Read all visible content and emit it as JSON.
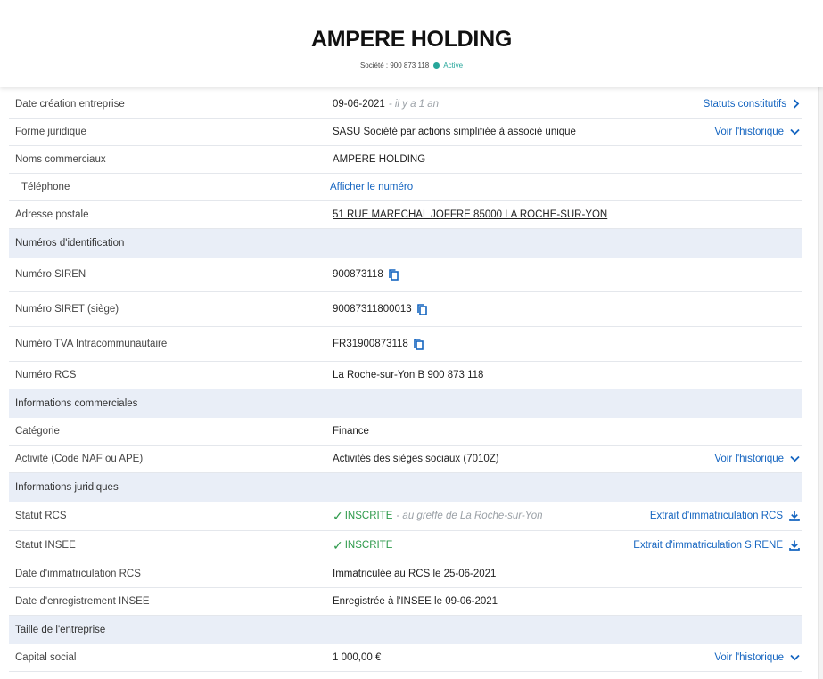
{
  "company": {
    "name": "AMPERE HOLDING",
    "subtitle": "Société : 900 873 118",
    "status": "Active"
  },
  "colors": {
    "accent": "#1565c0",
    "section_bg": "#e9eef7",
    "active": "#26a69a",
    "ok": "#2e9a4b"
  },
  "rows": {
    "creation": {
      "label": "Date création entreprise",
      "value": "09-06-2021",
      "hint": "- il y a 1 an",
      "action": "Statuts constitutifs"
    },
    "forme": {
      "label": "Forme juridique",
      "value": "SASU Société par actions simplifiée à associé unique",
      "action": "Voir l'historique"
    },
    "noms": {
      "label": "Noms commerciaux",
      "value": "AMPERE HOLDING"
    },
    "telephone": {
      "label": "Téléphone",
      "value": "Afficher le numéro"
    },
    "adresse": {
      "label": "Adresse postale",
      "value": "51 RUE MARECHAL JOFFRE 85000 LA ROCHE-SUR-YON"
    },
    "section_ident": {
      "label": "Numéros d'identification"
    },
    "siren": {
      "label": "Numéro SIREN",
      "value": "900873118"
    },
    "siret": {
      "label": "Numéro SIRET (siège)",
      "value": "90087311800013"
    },
    "tva": {
      "label": "Numéro TVA Intracommunautaire",
      "value": "FR31900873118"
    },
    "rcs": {
      "label": "Numéro RCS",
      "value": "La Roche-sur-Yon B 900 873 118"
    },
    "section_comm": {
      "label": "Informations commerciales"
    },
    "categorie": {
      "label": "Catégorie",
      "value": "Finance"
    },
    "activite": {
      "label": "Activité (Code NAF ou APE)",
      "value": "Activités des sièges sociaux (7010Z)",
      "action": "Voir l'historique"
    },
    "section_jur": {
      "label": "Informations juridiques"
    },
    "statut_rcs": {
      "label": "Statut RCS",
      "value": "INSCRITE",
      "hint": "- au greffe de La Roche-sur-Yon",
      "action": "Extrait d'immatriculation RCS"
    },
    "statut_insee": {
      "label": "Statut INSEE",
      "value": "INSCRITE",
      "action": "Extrait d'immatriculation SIRENE"
    },
    "date_rcs": {
      "label": "Date d'immatriculation RCS",
      "value": "Immatriculée au RCS le 25-06-2021"
    },
    "date_insee": {
      "label": "Date d'enregistrement INSEE",
      "value": "Enregistrée à l'INSEE le 09-06-2021"
    },
    "section_taille": {
      "label": "Taille de l'entreprise"
    },
    "capital": {
      "label": "Capital social",
      "value": "1 000,00 €",
      "action": "Voir l'historique"
    }
  }
}
